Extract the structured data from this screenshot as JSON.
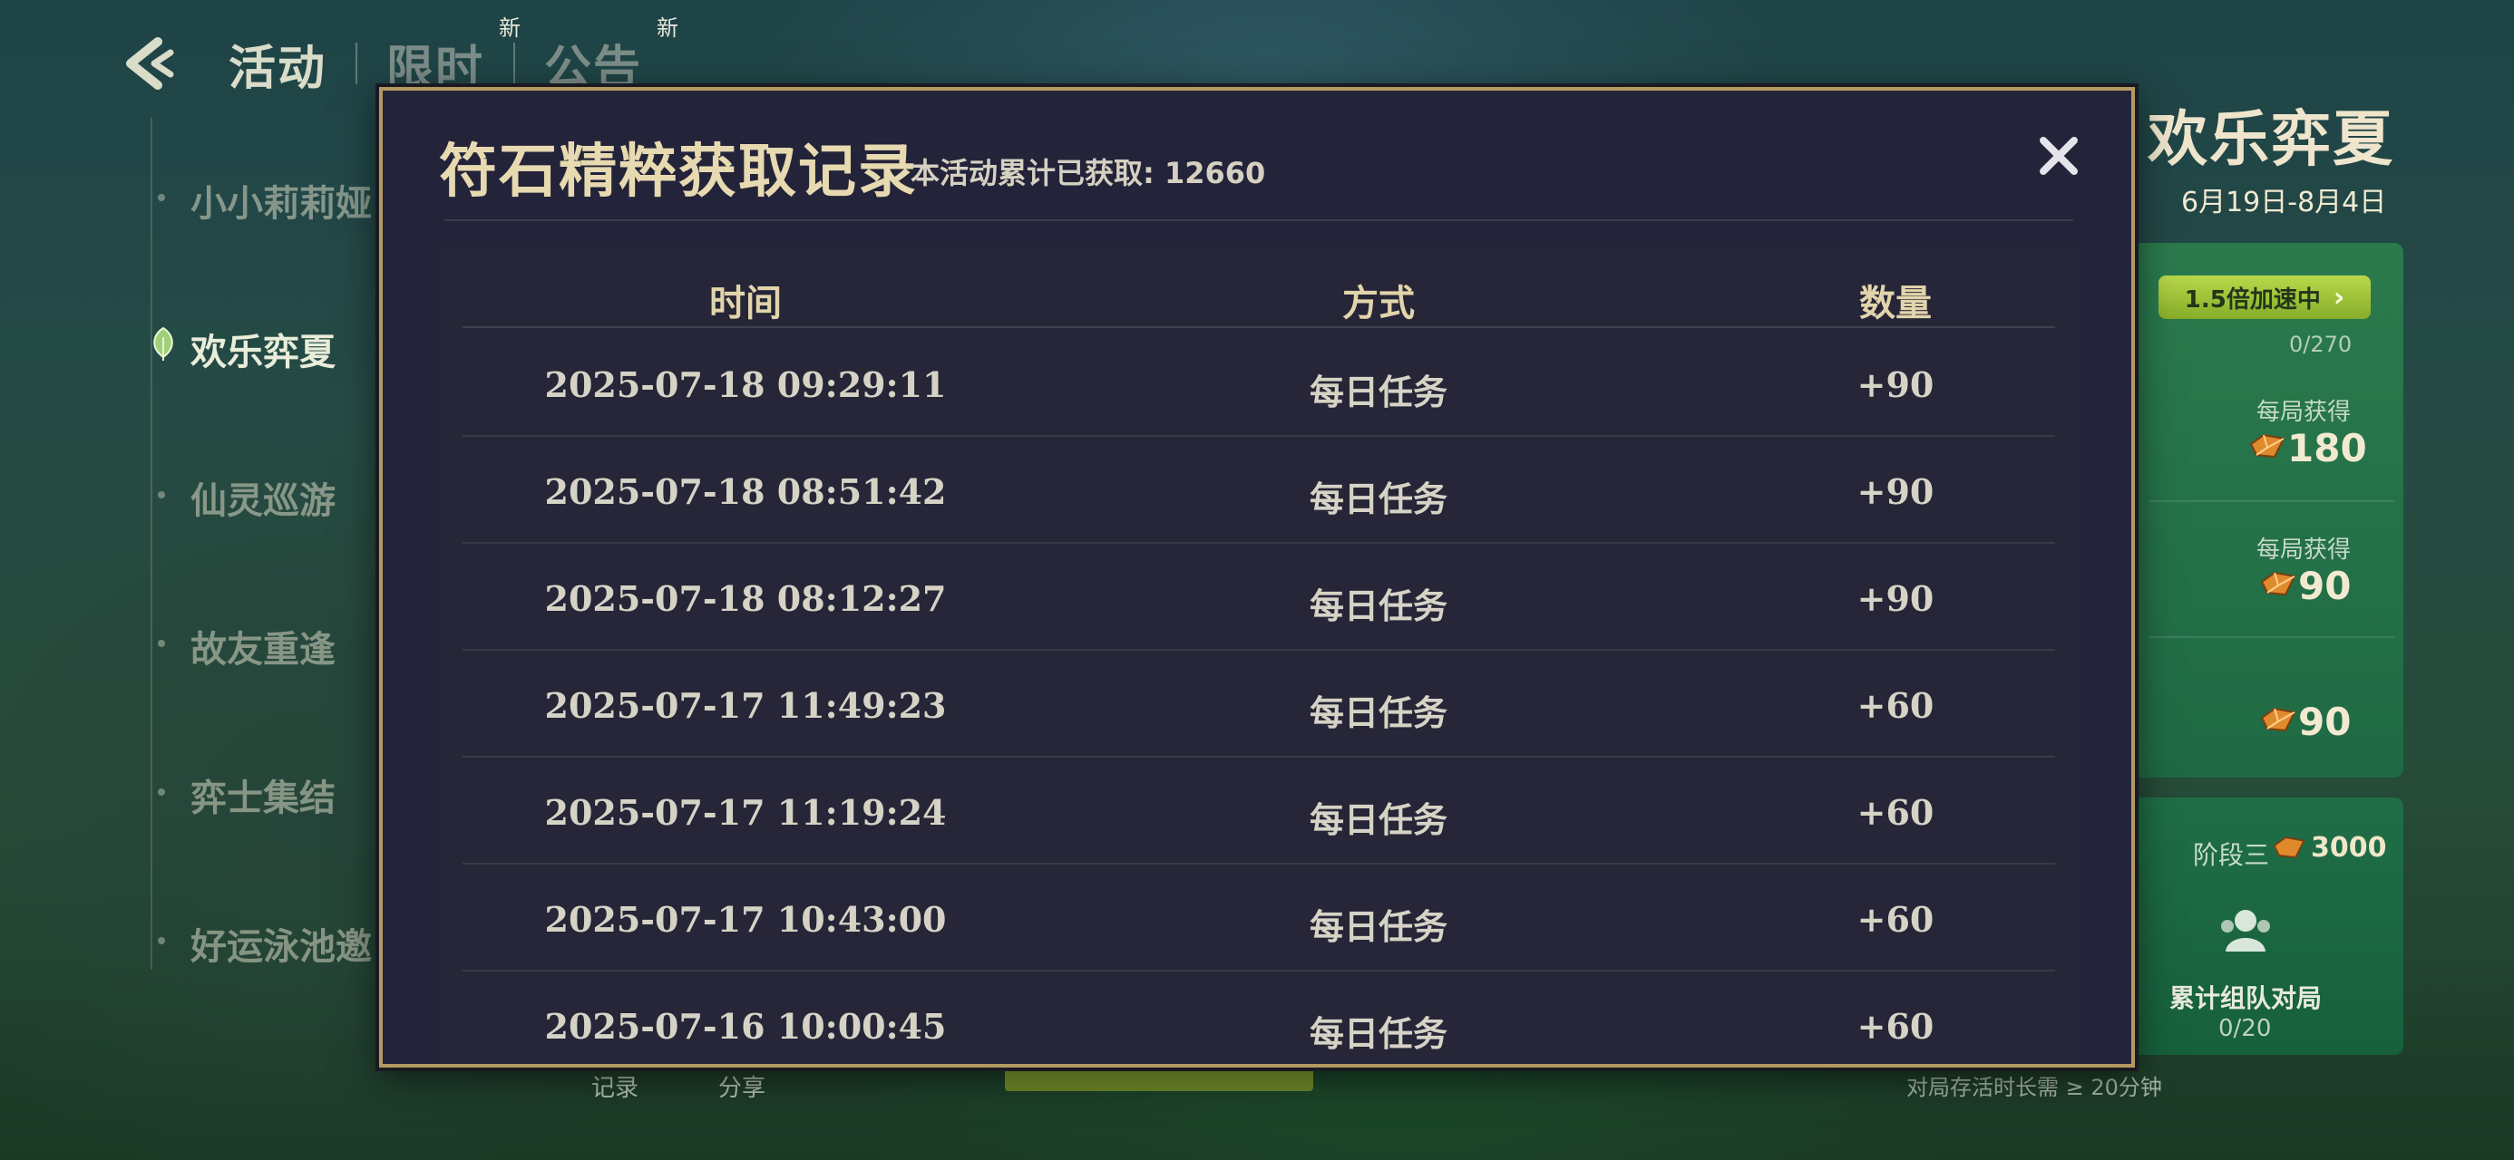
{
  "nav": {
    "tabs": [
      {
        "label": "活动",
        "badge": ""
      },
      {
        "label": "限时",
        "badge": "新"
      },
      {
        "label": "公告",
        "badge": "新"
      }
    ]
  },
  "sidebar": {
    "items": [
      {
        "label": "小小莉莉娅",
        "active": false
      },
      {
        "label": "欢乐弈夏",
        "active": true
      },
      {
        "label": "仙灵巡游",
        "active": false
      },
      {
        "label": "故友重逢",
        "active": false
      },
      {
        "label": "弈士集结",
        "active": false
      },
      {
        "label": "好运泳池邀",
        "active": false
      }
    ]
  },
  "right_panel": {
    "title": "欢乐弈夏",
    "date_range": "6月19日-8月4日",
    "speed_label": "1.5倍加速中",
    "progress": "0/270",
    "gains": [
      {
        "label": "每局获得",
        "value": "180"
      },
      {
        "label": "每局获得",
        "value": "90"
      },
      {
        "label": "",
        "value": "90"
      }
    ],
    "stage_label": "阶段三",
    "stage_value": "3000",
    "team_label": "累计组队对局",
    "team_progress": "0/20",
    "bottom_hint": "对局存活时长需 ≥ 20分钟",
    "record_label": "记录",
    "share_label": "分享"
  },
  "modal": {
    "title": "符石精粹获取记录",
    "subtitle": "本活动累计已获取: 12660",
    "columns": [
      "时间",
      "方式",
      "数量"
    ],
    "rows": [
      {
        "time": "2025-07-18 09:29:11",
        "method": "每日任务",
        "amount": "+90"
      },
      {
        "time": "2025-07-18 08:51:42",
        "method": "每日任务",
        "amount": "+90"
      },
      {
        "time": "2025-07-18 08:12:27",
        "method": "每日任务",
        "amount": "+90"
      },
      {
        "time": "2025-07-17 11:49:23",
        "method": "每日任务",
        "amount": "+60"
      },
      {
        "time": "2025-07-17 11:19:24",
        "method": "每日任务",
        "amount": "+60"
      },
      {
        "time": "2025-07-17 10:43:00",
        "method": "每日任务",
        "amount": "+60"
      },
      {
        "time": "2025-07-16 10:00:45",
        "method": "每日任务",
        "amount": "+60"
      }
    ]
  },
  "colors": {
    "modal_bg": "#23233a",
    "modal_border": "#b49a62",
    "header_text": "#e2d4ab",
    "accent_green": "#b9d84a"
  }
}
